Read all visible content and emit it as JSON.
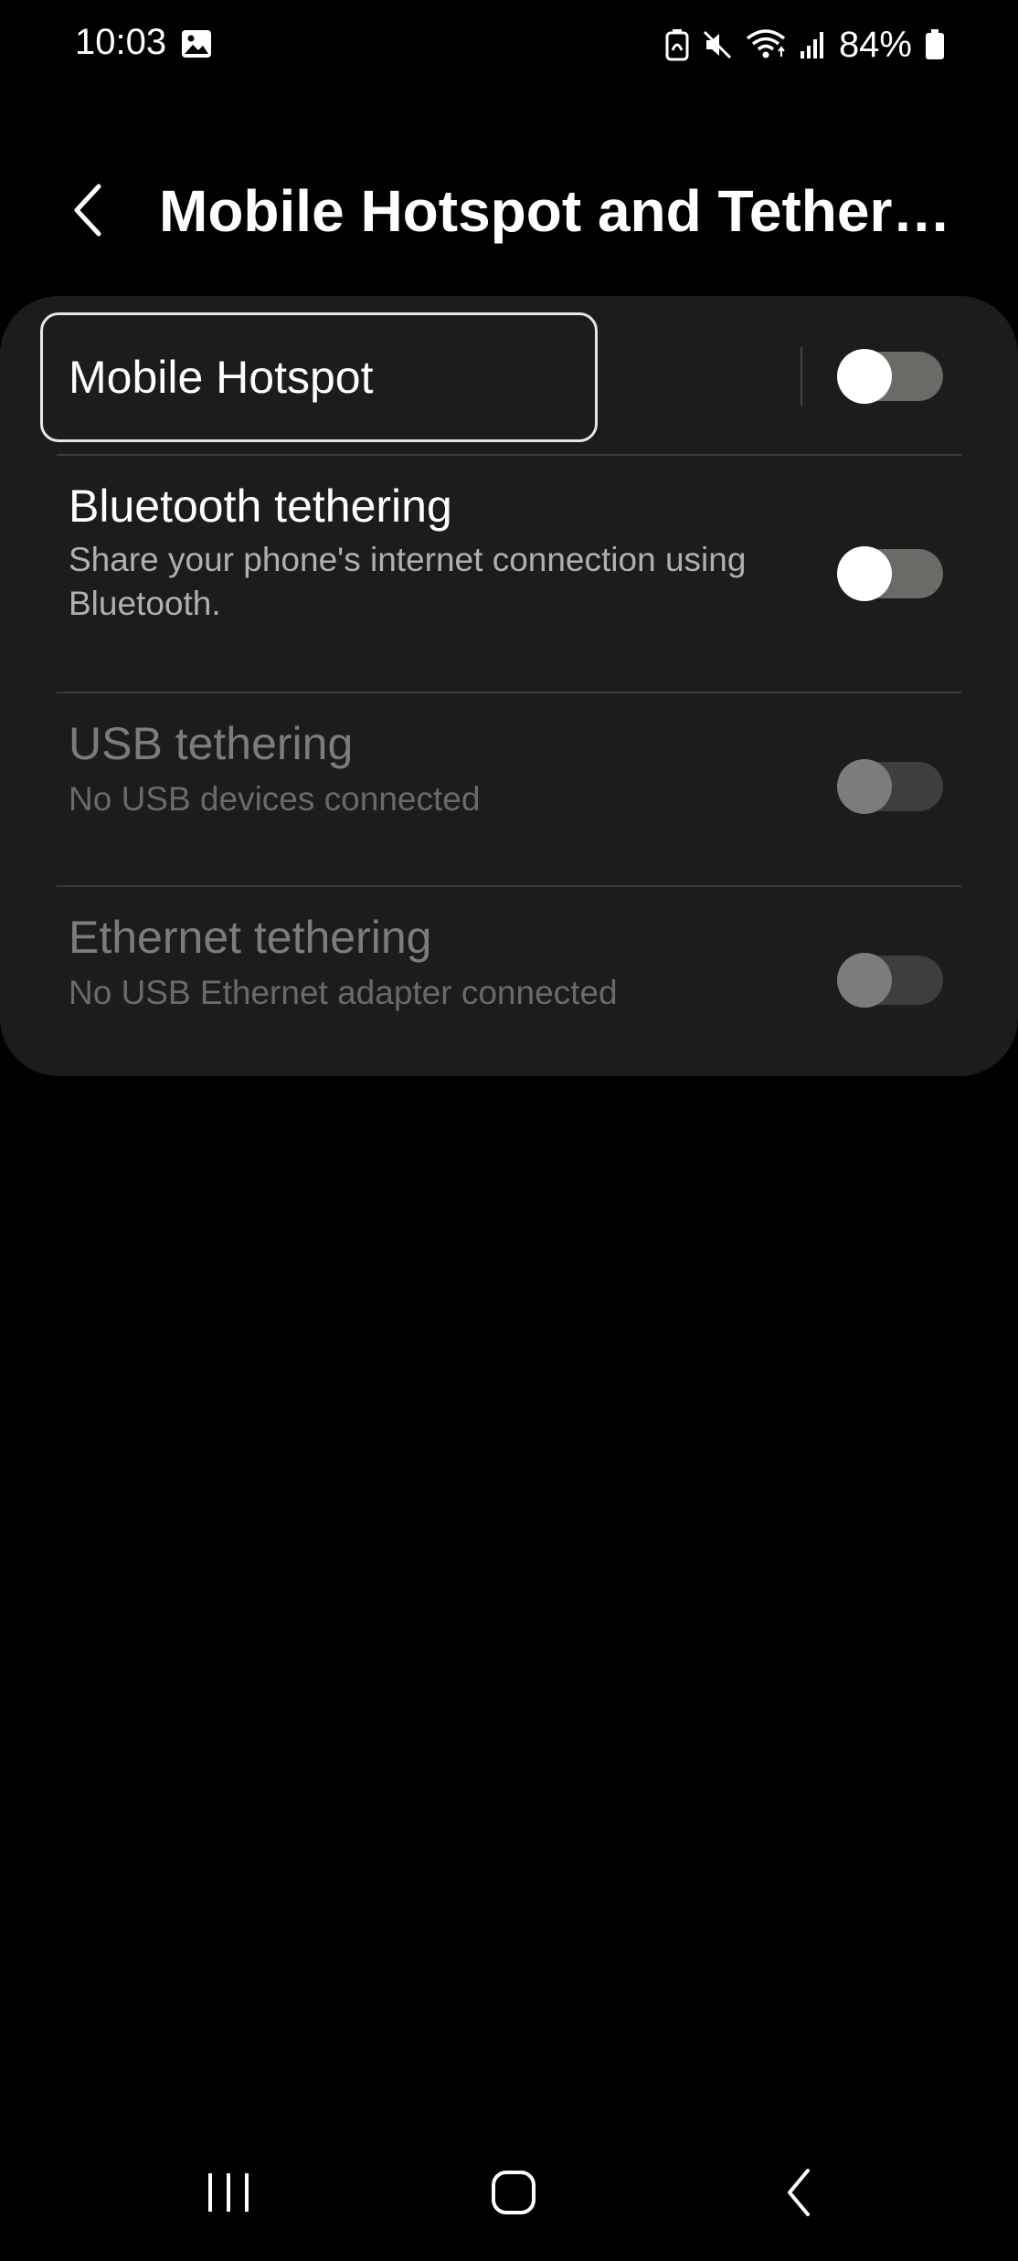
{
  "status_bar": {
    "time": "10:03",
    "battery_percent": "84%",
    "icons": [
      "gallery-icon",
      "battery-saver-icon",
      "mute-icon",
      "wifi-icon",
      "signal-icon",
      "battery-icon"
    ]
  },
  "header": {
    "back_icon": "chevron-left-icon",
    "title": "Mobile Hotspot and Tetheri…"
  },
  "settings": [
    {
      "title": "Mobile Hotspot",
      "subtitle": "",
      "enabled": true,
      "on": false
    },
    {
      "title": "Bluetooth tethering",
      "subtitle": "Share your phone's internet connection using Bluetooth.",
      "enabled": true,
      "on": false
    },
    {
      "title": "USB tethering",
      "subtitle": "No USB devices connected",
      "enabled": false,
      "on": false
    },
    {
      "title": "Ethernet tethering",
      "subtitle": "No USB Ethernet adapter connected",
      "enabled": false,
      "on": false
    }
  ],
  "nav_bar": {
    "icons": [
      "recents-icon",
      "home-icon",
      "back-icon"
    ]
  },
  "colors": {
    "background": "#000000",
    "card": "#1c1c1c",
    "toggle_track_off": "#6a6a66",
    "disabled_text": "#7c7c7c"
  }
}
